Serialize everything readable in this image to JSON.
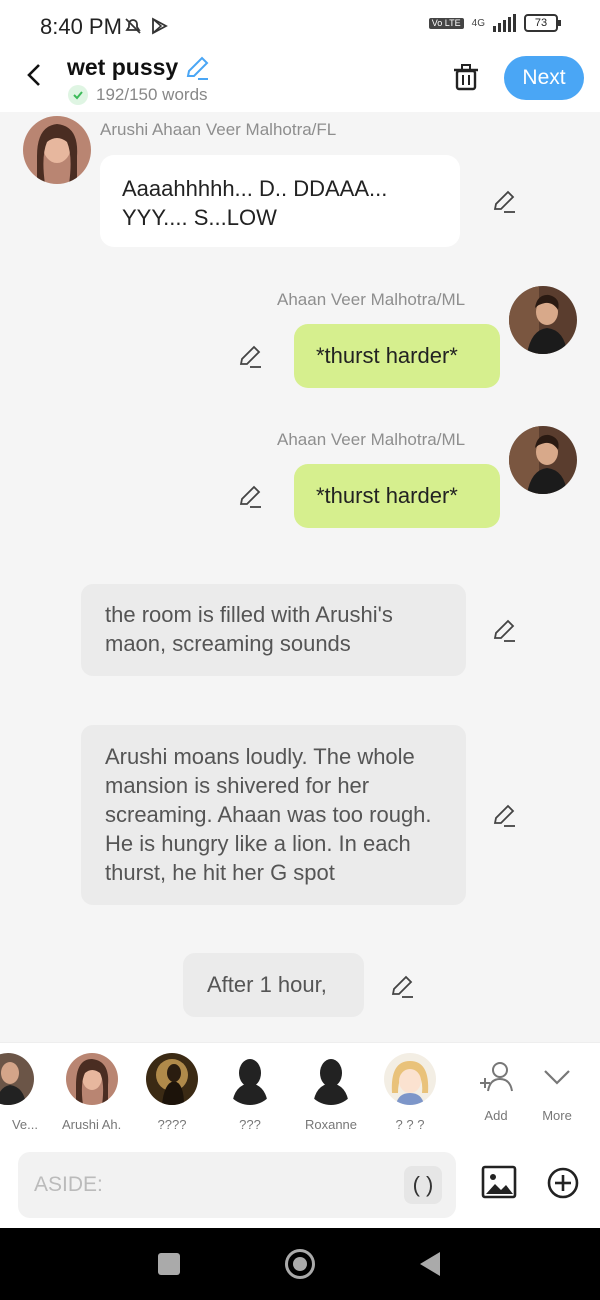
{
  "status": {
    "time": "8:40 PM",
    "volte": "Vo LTE",
    "network": "4G",
    "battery": "73"
  },
  "header": {
    "title": "wet pussy",
    "word_count": "192/150 words",
    "next_label": "Next"
  },
  "messages": [
    {
      "sender": "Arushi Ahaan Veer Malhotra/FL",
      "text": "Aaaahhhhh... D.. DDAAA... YYY.... S...LOW"
    },
    {
      "sender": "Ahaan Veer Malhotra/ML",
      "text": "*thurst harder*"
    },
    {
      "sender": "Ahaan Veer Malhotra/ML",
      "text": "*thurst harder*"
    },
    {
      "sender": "",
      "text": "the room is filled with Arushi's maon, screaming sounds"
    },
    {
      "sender": "",
      "text": "Arushi moans loudly. The whole mansion is shivered for her screaming. Ahaan was too rough. He is hungry like a lion. In each thurst, he hit her G spot"
    },
    {
      "sender": "",
      "text": "After 1 hour,"
    }
  ],
  "characters": [
    {
      "name": "Ve...",
      "color": "#8b6b5b"
    },
    {
      "name": "Arushi Ah...",
      "color": "#a36a55"
    },
    {
      "name": "????",
      "color": "#7a5c2e"
    },
    {
      "name": "???",
      "color": "#222222"
    },
    {
      "name": "Roxanne",
      "color": "#222222"
    },
    {
      "name": "? ? ?",
      "color": "#e9c27a"
    }
  ],
  "actions": {
    "add_label": "Add",
    "more_label": "More"
  },
  "input": {
    "placeholder": "ASIDE:",
    "paren_label": "( )"
  },
  "colors": {
    "accent": "#4aa6f5",
    "green_bubble": "#d6ef8e",
    "grey_bubble": "#ebebeb"
  }
}
